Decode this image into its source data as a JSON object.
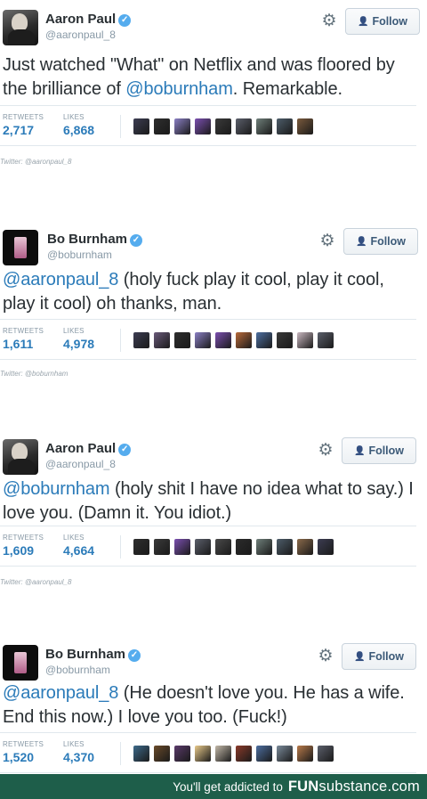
{
  "tweets": [
    {
      "author": "Aaron Paul",
      "handle": "@aaronpaul_8",
      "avatar": "aaron",
      "follow_label": "Follow",
      "text_parts": [
        {
          "t": "Just watched \"What\" on Netflix and was floored by the brilliance of  "
        },
        {
          "t": "@boburnham",
          "mention": true
        },
        {
          "t": ". Remarkable."
        }
      ],
      "retweets_label": "RETWEETS",
      "retweets": "2,717",
      "likes_label": "LIKES",
      "likes": "6,868",
      "liker_colors": [
        "#3c3d52",
        "#2e2e2e",
        "#8a7fc4",
        "#7b4fb0",
        "#3a3a3a",
        "#5b5f6b",
        "#6f7f7a",
        "#4d5d6a",
        "#7a5a3c"
      ],
      "source": "Twitter: @aaronpaul_8"
    },
    {
      "author": "Bo Burnham",
      "handle": "@boburnham",
      "avatar": "bo",
      "follow_label": "Follow",
      "text_parts": [
        {
          "t": "@aaronpaul_8",
          "mention": true
        },
        {
          "t": " (holy fuck play it cool, play it cool, play it cool) oh thanks, man."
        }
      ],
      "retweets_label": "RETWEETS",
      "retweets": "1,611",
      "likes_label": "LIKES",
      "likes": "4,978",
      "liker_colors": [
        "#3c3d52",
        "#6a5a7a",
        "#2e2e2e",
        "#8a7fc4",
        "#7b4fb0",
        "#b86a3a",
        "#4d6fa0",
        "#3a3a3a",
        "#c9b8c0",
        "#5b5f6b"
      ],
      "source": "Twitter: @boburnham"
    },
    {
      "author": "Aaron Paul",
      "handle": "@aaronpaul_8",
      "avatar": "aaron",
      "follow_label": "Follow",
      "text_parts": [
        {
          "t": "@boburnham",
          "mention": true
        },
        {
          "t": " (holy shit I have no idea what to say.) I love you. (Damn it. You idiot.)"
        }
      ],
      "retweets_label": "RETWEETS",
      "retweets": "1,609",
      "likes_label": "LIKES",
      "likes": "4,664",
      "liker_colors": [
        "#2e2e2e",
        "#3a3a3a",
        "#7b4fb0",
        "#5b5f6b",
        "#4a4a4a",
        "#2b2b2b",
        "#6f7f7a",
        "#4d5d6a",
        "#8a6a4a",
        "#3c3d52"
      ],
      "source": "Twitter: @aaronpaul_8"
    },
    {
      "author": "Bo Burnham",
      "handle": "@boburnham",
      "avatar": "bo",
      "follow_label": "Follow",
      "text_parts": [
        {
          "t": "@aaronpaul_8",
          "mention": true
        },
        {
          "t": " (He doesn't love you. He has a wife. End this now.) I love you too. (Fuck!)"
        }
      ],
      "retweets_label": "RETWEETS",
      "retweets": "1,520",
      "likes_label": "LIKES",
      "likes": "4,370",
      "liker_colors": [
        "#3d6a8a",
        "#6a4a2a",
        "#5a3a6a",
        "#e8c98a",
        "#c2b8a8",
        "#8a3a2a",
        "#4d6fa0",
        "#7a8a9a",
        "#b87a4a",
        "#5b5f6b"
      ],
      "source": ""
    }
  ],
  "footer": {
    "tagline": "You'll get addicted to",
    "brand_bold": "FUN",
    "brand_light": "substance",
    "brand_suffix": ".com"
  },
  "colors": {
    "mention": "#2b7bb9",
    "footer_bg": "#1e5e4a",
    "verified": "#55acee"
  },
  "icons": {
    "gear": "gear-icon",
    "follow": "add-person-icon",
    "verified": "verified-badge-icon"
  }
}
